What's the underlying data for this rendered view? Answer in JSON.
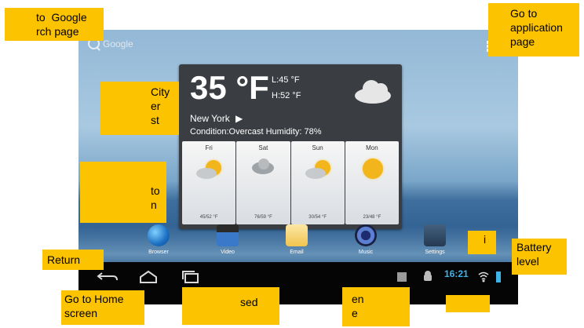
{
  "home_screen": {
    "google_label": "Google",
    "weather": {
      "temperature": "35 °F",
      "low": "L:45 °F",
      "high": "H:52 °F",
      "city": "New York",
      "condition": "Condition:Overcast Humidity: 78%",
      "forecast": [
        {
          "day": "Fri",
          "temps": "45/52 °F"
        },
        {
          "day": "Sat",
          "temps": "76/59 °F"
        },
        {
          "day": "Sun",
          "temps": "30/54 °F"
        },
        {
          "day": "Mon",
          "temps": "23/48 °F"
        }
      ]
    },
    "dock": [
      {
        "label": "Browser",
        "icon": "globe-icon"
      },
      {
        "label": "Video",
        "icon": "clapperboard-icon"
      },
      {
        "label": "Email",
        "icon": "envelope-icon"
      },
      {
        "label": "Music",
        "icon": "speaker-icon"
      },
      {
        "label": "Settings",
        "icon": "sliders-icon"
      }
    ],
    "status": {
      "time": "16:21"
    }
  },
  "callouts": {
    "google": "to  Google\nrch page",
    "apps": "Go to\napplication\npage",
    "city": "City\ner\nst",
    "browser": "to\nn",
    "return": "Return",
    "home": "Go to Home\nscreen",
    "recent": "sed",
    "screenshot": "en\ne",
    "wifi": "i",
    "battery": "Battery\nlevel",
    "clock": ""
  },
  "colors": {
    "callout": "#fcc300",
    "clock": "#3db3e8"
  }
}
